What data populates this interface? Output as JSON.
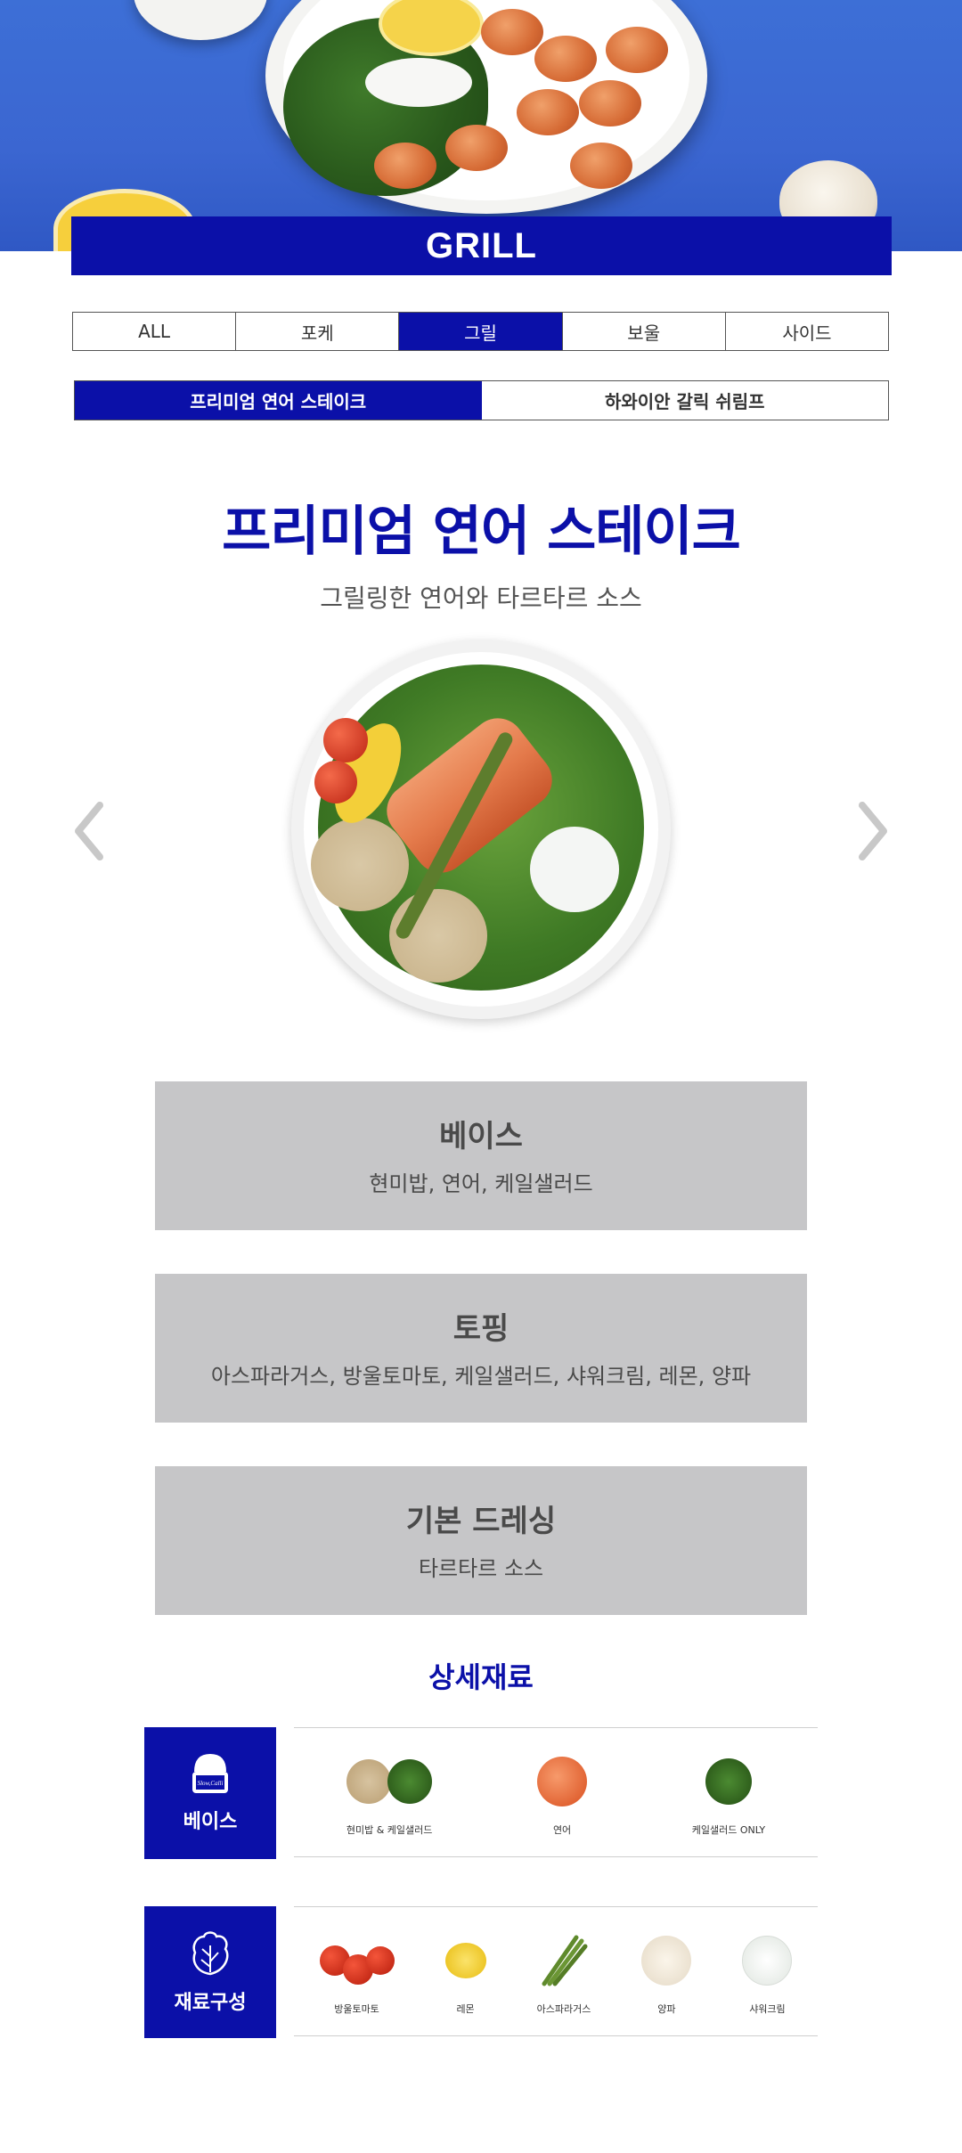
{
  "hero": {
    "title": "GRILL"
  },
  "category_tabs": [
    {
      "label": "ALL",
      "active": false
    },
    {
      "label": "포케",
      "active": false
    },
    {
      "label": "그릴",
      "active": true
    },
    {
      "label": "보울",
      "active": false
    },
    {
      "label": "사이드",
      "active": false
    }
  ],
  "menu_tabs": [
    {
      "label": "프리미엄 연어 스테이크",
      "active": true
    },
    {
      "label": "하와이안 갈릭 쉬림프",
      "active": false
    }
  ],
  "product": {
    "name": "프리미엄 연어 스테이크",
    "description": "그릴링한 연어와 타르타르 소스"
  },
  "info": {
    "base": {
      "title": "베이스",
      "text": "현미밥, 연어, 케일샐러드"
    },
    "topping": {
      "title": "토핑",
      "text": "아스파라거스, 방울토마토, 케일샐러드, 샤워크림, 레몬, 양파"
    },
    "dressing": {
      "title": "기본 드레싱",
      "text": "타르타르 소스"
    }
  },
  "details": {
    "title": "상세재료",
    "base_row": {
      "label": "베이스",
      "logo_text": "Slow,Calli",
      "items": [
        "현미밥 & 케일샐러드",
        "연어",
        "케일샐러드 ONLY"
      ]
    },
    "ingredient_row": {
      "label": "재료구성",
      "items": [
        "방울토마토",
        "레몬",
        "아스파라거스",
        "양파",
        "샤워크림"
      ]
    }
  },
  "colors": {
    "brand": "#0b10a8",
    "info_box": "#c6c6c8",
    "arrow": "#c8c8c8"
  },
  "icons": [
    "chevron-left-icon",
    "chevron-right-icon",
    "bowl-icon",
    "lettuce-icon"
  ]
}
